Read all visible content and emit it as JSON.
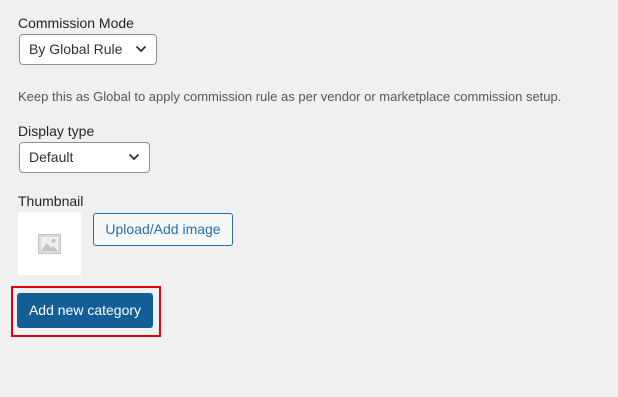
{
  "commission_mode": {
    "label": "Commission Mode",
    "selected": "By Global Rule",
    "help_text": "Keep this as Global to apply commission rule as per vendor or marketplace commission setup."
  },
  "display_type": {
    "label": "Display type",
    "selected": "Default"
  },
  "thumbnail": {
    "label": "Thumbnail",
    "upload_button": "Upload/Add image"
  },
  "submit": {
    "label": "Add new category"
  },
  "colors": {
    "background": "#f0f0f1",
    "primary_button": "#135e96",
    "link_blue": "#2271b1",
    "highlight_border": "#e3000f"
  },
  "icons": {
    "dropdown": "chevron-down-icon",
    "thumbnail_placeholder": "image-placeholder-icon"
  }
}
